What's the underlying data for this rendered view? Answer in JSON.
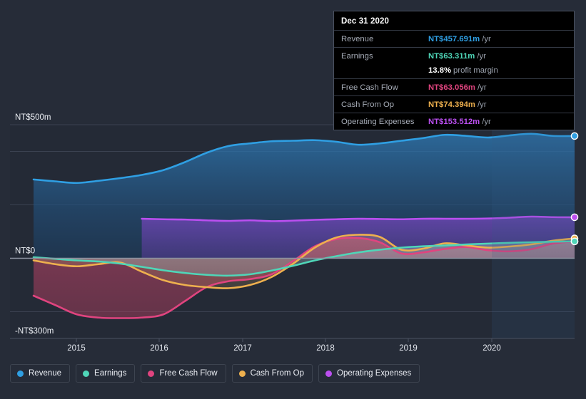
{
  "chart_data": {
    "type": "area",
    "title": "",
    "xlabel": "",
    "ylabel": "",
    "currency": "NT$",
    "unit": "m",
    "ylim": [
      -300,
      500
    ],
    "y_ticks": [
      500,
      0,
      -300
    ],
    "y_tick_labels": [
      "NT$500m",
      "NT$0",
      "-NT$300m"
    ],
    "gridlines": [
      500,
      400,
      200,
      0,
      -200,
      -300
    ],
    "x": [
      "2015",
      "2016",
      "2017",
      "2018",
      "2019",
      "2020"
    ],
    "x_tick_labels": [
      "2015",
      "2016",
      "2017",
      "2018",
      "2019",
      "2020"
    ],
    "legend_position": "bottom",
    "grid": true,
    "forecast_start": "2020",
    "series": [
      {
        "name": "Revenue",
        "color": "#2f9fe3",
        "latest_value": 457.691,
        "values": [
          295,
          288,
          282,
          290,
          300,
          312,
          330,
          360,
          395,
          420,
          430,
          438,
          440,
          442,
          436,
          425,
          430,
          440,
          450,
          462,
          458,
          452,
          460,
          466,
          458,
          457.691
        ]
      },
      {
        "name": "Earnings",
        "color": "#4fd6b8",
        "latest_value": 63.311,
        "values": [
          4,
          -2,
          -8,
          -12,
          -20,
          -32,
          -45,
          -55,
          -62,
          -65,
          -60,
          -46,
          -28,
          -8,
          8,
          22,
          32,
          40,
          45,
          48,
          52,
          55,
          58,
          60,
          62,
          63.311
        ]
      },
      {
        "name": "Free Cash Flow",
        "color": "#e0447f",
        "latest_value": 63.056,
        "values": [
          -140,
          -175,
          -210,
          -222,
          -224,
          -222,
          -210,
          -160,
          -108,
          -86,
          -78,
          -60,
          -10,
          45,
          72,
          76,
          60,
          18,
          22,
          35,
          42,
          30,
          26,
          34,
          55,
          63.056
        ]
      },
      {
        "name": "Cash From Op",
        "color": "#eeb04e",
        "latest_value": 74.394,
        "values": [
          -8,
          -22,
          -30,
          -22,
          -16,
          -50,
          -82,
          -100,
          -108,
          -112,
          -100,
          -70,
          -20,
          40,
          78,
          88,
          80,
          32,
          36,
          56,
          48,
          40,
          44,
          52,
          66,
          74.394
        ]
      },
      {
        "name": "Operating Expenses",
        "color": "#bb4ff0",
        "latest_value": 153.512,
        "values": [
          null,
          null,
          null,
          null,
          null,
          148,
          146,
          145,
          142,
          140,
          142,
          139,
          141,
          144,
          146,
          148,
          147,
          146,
          148,
          148,
          148,
          149,
          152,
          156,
          154,
          153.512
        ]
      }
    ]
  },
  "tooltip": {
    "date": "Dec 31 2020",
    "rows": [
      {
        "label": "Revenue",
        "value": "NT$457.691m",
        "unit": "/yr",
        "color": "#2f9fe3"
      },
      {
        "label": "Earnings",
        "value": "NT$63.311m",
        "unit": "/yr",
        "color": "#4fd6b8"
      },
      {
        "label": "",
        "value": "13.8%",
        "unit": "profit margin",
        "color": "#ffffff"
      },
      {
        "label": "Free Cash Flow",
        "value": "NT$63.056m",
        "unit": "/yr",
        "color": "#e0447f"
      },
      {
        "label": "Cash From Op",
        "value": "NT$74.394m",
        "unit": "/yr",
        "color": "#eeb04e"
      },
      {
        "label": "Operating Expenses",
        "value": "NT$153.512m",
        "unit": "/yr",
        "color": "#bb4ff0"
      }
    ]
  },
  "legend": {
    "items": [
      {
        "label": "Revenue",
        "color": "#2f9fe3"
      },
      {
        "label": "Earnings",
        "color": "#4fd6b8"
      },
      {
        "label": "Free Cash Flow",
        "color": "#e0447f"
      },
      {
        "label": "Cash From Op",
        "color": "#eeb04e"
      },
      {
        "label": "Operating Expenses",
        "color": "#bb4ff0"
      }
    ]
  }
}
